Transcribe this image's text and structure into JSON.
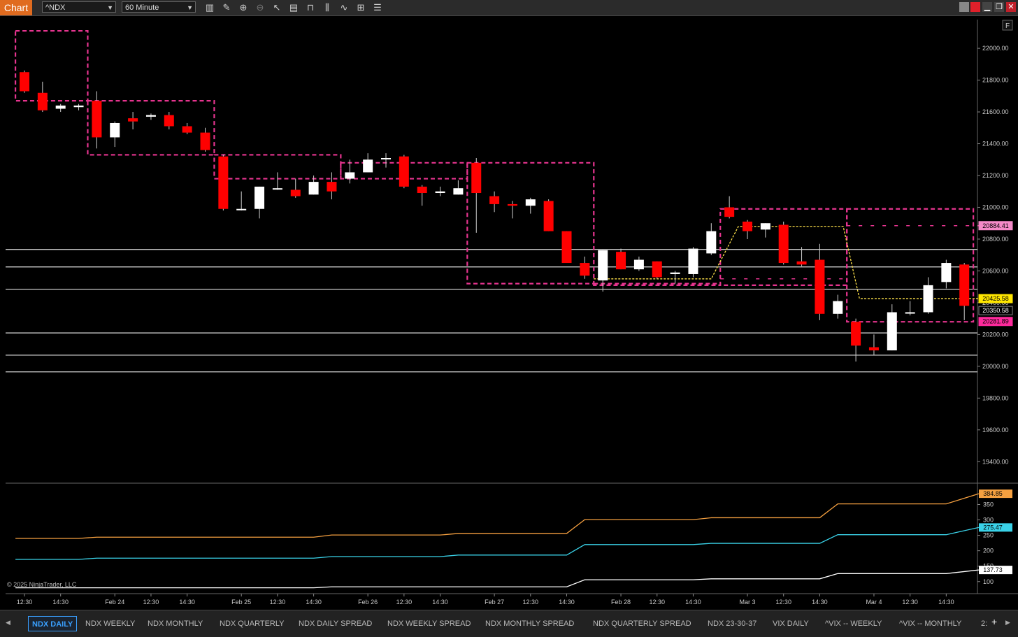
{
  "toolbar": {
    "chart_label": "Chart",
    "instrument": "^NDX",
    "interval": "60 Minute",
    "tools": [
      "bar-chart-icon",
      "pencil-icon",
      "zoom-in-icon",
      "zoom-out-icon",
      "cursor-icon",
      "properties-icon",
      "template-icon",
      "indicators-icon",
      "strategies-icon",
      "data-box-icon",
      "list-icon"
    ]
  },
  "corner_button": "F",
  "copyright": "© 2025 NinjaTrader, LLC",
  "tabs": [
    {
      "label": "NDX DAILY",
      "active": true
    },
    {
      "label": "NDX WEEKLY"
    },
    {
      "label": "NDX MONTHLY"
    },
    {
      "label": "NDX QUARTERLY"
    },
    {
      "label": "NDX DAILY SPREAD"
    },
    {
      "label": "NDX WEEKLY SPREAD"
    },
    {
      "label": "NDX MONTHLY SPREAD"
    },
    {
      "label": "NDX QUARTERLY SPREAD"
    },
    {
      "label": "NDX 23-30-37"
    },
    {
      "label": "VIX DAILY"
    },
    {
      "label": "^VIX -- WEEKLY"
    },
    {
      "label": "^VIX -- MONTHLY"
    },
    {
      "label": "2:"
    }
  ],
  "colors": {
    "bull": "#ffffff",
    "bear": "#ff0000",
    "pink": "#e6348f",
    "yellow": "#ffe24a",
    "orange": "#f5a040",
    "cyan": "#3ad2e8",
    "grid": "#e0e0e0",
    "axis_text": "#cccccc"
  },
  "chart_data": {
    "type": "candlestick",
    "instrument": "^NDX",
    "interval": "60 Minute",
    "x_tick_labels": [
      "12:30",
      "14:30",
      "Feb 24",
      "12:30",
      "14:30",
      "Feb 25",
      "12:30",
      "14:30",
      "Feb 26",
      "12:30",
      "14:30",
      "Feb 27",
      "12:30",
      "14:30",
      "Feb 28",
      "12:30",
      "14:30",
      "Mar 3",
      "12:30",
      "14:30",
      "Mar 4",
      "12:30",
      "14:30"
    ],
    "x_tick_bar_index": [
      0,
      2,
      5,
      7,
      9,
      12,
      14,
      16,
      19,
      21,
      23,
      26,
      28,
      30,
      33,
      35,
      37,
      40,
      42,
      44,
      47,
      49,
      51
    ],
    "price_axis": {
      "min": 19300,
      "max": 22150,
      "ticks": [
        19400,
        19600,
        19800,
        20000,
        20200,
        20400,
        20600,
        20800,
        21000,
        21200,
        21400,
        21600,
        21800,
        22000
      ],
      "tick_labels": [
        "19400.00",
        "19600.00",
        "19800.00",
        "20000.00",
        "20200.00",
        "20400.00",
        "20600.00",
        "20800.00",
        "21000.00",
        "21200.00",
        "21400.00",
        "21600.00",
        "21800.00",
        "22000.00"
      ]
    },
    "candles": [
      [
        21850,
        21860,
        21720,
        21730
      ],
      [
        21720,
        21790,
        21600,
        21610
      ],
      [
        21620,
        21650,
        21600,
        21640
      ],
      [
        21630,
        21650,
        21610,
        21640
      ],
      [
        21670,
        21730,
        21370,
        21440
      ],
      [
        21440,
        21540,
        21380,
        21530
      ],
      [
        21560,
        21600,
        21490,
        21540
      ],
      [
        21570,
        21590,
        21550,
        21580
      ],
      [
        21580,
        21600,
        21490,
        21510
      ],
      [
        21510,
        21530,
        21460,
        21470
      ],
      [
        21470,
        21500,
        21350,
        21360
      ],
      [
        21320,
        21330,
        20980,
        20990
      ],
      [
        20990,
        21100,
        20980,
        20990
      ],
      [
        20990,
        21130,
        20930,
        21130
      ],
      [
        21120,
        21220,
        21110,
        21120
      ],
      [
        21110,
        21180,
        21060,
        21070
      ],
      [
        21080,
        21200,
        21080,
        21160
      ],
      [
        21160,
        21220,
        21050,
        21100
      ],
      [
        21180,
        21300,
        21150,
        21220
      ],
      [
        21220,
        21340,
        21220,
        21300
      ],
      [
        21310,
        21340,
        21250,
        21310
      ],
      [
        21320,
        21330,
        21120,
        21130
      ],
      [
        21130,
        21140,
        21010,
        21090
      ],
      [
        21090,
        21130,
        21070,
        21100
      ],
      [
        21080,
        21170,
        21080,
        21120
      ],
      [
        21280,
        21310,
        20840,
        21090
      ],
      [
        21070,
        21100,
        20970,
        21020
      ],
      [
        21020,
        21040,
        20930,
        21010
      ],
      [
        21010,
        21060,
        20960,
        21050
      ],
      [
        21040,
        21050,
        20850,
        20850
      ],
      [
        20850,
        20850,
        20650,
        20650
      ],
      [
        20650,
        20690,
        20550,
        20570
      ],
      [
        20540,
        20730,
        20470,
        20730
      ],
      [
        20720,
        20740,
        20610,
        20610
      ],
      [
        20610,
        20690,
        20600,
        20670
      ],
      [
        20660,
        20660,
        20550,
        20560
      ],
      [
        20580,
        20600,
        20520,
        20590
      ],
      [
        20580,
        20750,
        20560,
        20740
      ],
      [
        20710,
        20900,
        20700,
        20850
      ],
      [
        21000,
        21070,
        20930,
        20940
      ],
      [
        20910,
        20920,
        20800,
        20850
      ],
      [
        20860,
        20900,
        20810,
        20900
      ],
      [
        20890,
        20910,
        20640,
        20650
      ],
      [
        20660,
        20750,
        20630,
        20640
      ],
      [
        20670,
        20770,
        20290,
        20330
      ],
      [
        20330,
        20450,
        20300,
        20410
      ],
      [
        20280,
        20300,
        20030,
        20130
      ],
      [
        20120,
        20200,
        20070,
        20100
      ],
      [
        20100,
        20390,
        20100,
        20340
      ],
      [
        20340,
        20410,
        20320,
        20340
      ],
      [
        20340,
        20560,
        20330,
        20510
      ],
      [
        20530,
        20670,
        20490,
        20650
      ],
      [
        20640,
        20650,
        20290,
        20380
      ]
    ],
    "horizontal_levels": [
      20735,
      20625,
      20485,
      20210,
      20070,
      19965
    ],
    "pink_boxes": [
      {
        "from": -0.5,
        "to": 3.5,
        "low": 21670,
        "high": 22110
      },
      {
        "from": 3.5,
        "to": 10.5,
        "low": 21330,
        "high": 21670
      },
      {
        "from": 10.5,
        "to": 17.5,
        "low": 21180,
        "high": 21330
      },
      {
        "from": 17.5,
        "to": 24.5,
        "low": 21180,
        "high": 21280
      },
      {
        "from": 24.5,
        "to": 31.5,
        "low": 20520,
        "high": 21280
      },
      {
        "from": 31.5,
        "to": 38.5,
        "low": 20510,
        "high": 20520
      },
      {
        "from": 38.5,
        "to": 45.5,
        "low": 20510,
        "high": 20990
      },
      {
        "from": 45.5,
        "to": 52.5,
        "low": 20280,
        "high": 20990
      }
    ],
    "pink_dashed_levels": [
      {
        "from": 38.5,
        "to": 45.5,
        "y": 20550,
        "style": "sparse"
      },
      {
        "from": 45.5,
        "to": 52.8,
        "y": 20884.41,
        "style": "sparse"
      }
    ],
    "yellow_path": [
      [
        31.5,
        20550
      ],
      [
        38,
        20550
      ],
      [
        39.5,
        20880
      ],
      [
        45.3,
        20880
      ],
      [
        46.2,
        20425.58
      ],
      [
        52.8,
        20425.58
      ]
    ],
    "price_markers": [
      {
        "label": "20884.41",
        "value": 20884.41,
        "bg": "#f48ac8",
        "fg": "#000"
      },
      {
        "label": "20425.58",
        "value": 20425.58,
        "bg": "#ffe600",
        "fg": "#000"
      },
      {
        "label": "20350.58",
        "value": 20350.58,
        "bg": "#000",
        "fg": "#fff",
        "border": "#888"
      },
      {
        "label": "20281.89",
        "value": 20281.89,
        "bg": "#ff2a9d",
        "fg": "#000"
      }
    ],
    "lower_panel": {
      "axis": {
        "min": 70,
        "max": 410,
        "ticks": [
          100,
          150,
          200,
          250,
          300,
          350
        ],
        "tick_labels": [
          "100",
          "150",
          "200",
          "250",
          "300",
          "350"
        ]
      },
      "series": [
        {
          "color": "#f5a040",
          "label": "384.85",
          "last": 384.85,
          "steps": [
            [
              -0.5,
              240
            ],
            [
              3,
              240
            ],
            [
              4,
              244
            ],
            [
              16,
              244
            ],
            [
              17,
              251
            ],
            [
              23,
              251
            ],
            [
              24,
              256
            ],
            [
              30,
              256
            ],
            [
              31,
              301
            ],
            [
              37,
              301
            ],
            [
              38,
              307
            ],
            [
              44,
              307
            ],
            [
              45,
              352
            ],
            [
              51,
              352
            ],
            [
              52.8,
              384.85
            ]
          ]
        },
        {
          "color": "#3ad2e8",
          "label": "275.47",
          "last": 275.47,
          "steps": [
            [
              -0.5,
              172
            ],
            [
              3,
              172
            ],
            [
              4,
              176
            ],
            [
              16,
              176
            ],
            [
              17,
              181
            ],
            [
              23,
              181
            ],
            [
              24,
              186
            ],
            [
              30,
              186
            ],
            [
              31,
              220
            ],
            [
              37,
              220
            ],
            [
              38,
              224
            ],
            [
              44,
              224
            ],
            [
              45,
              252
            ],
            [
              51,
              252
            ],
            [
              52.8,
              275.47
            ]
          ]
        },
        {
          "color": "#ffffff",
          "label": "137.73",
          "last": 137.73,
          "steps": [
            [
              -0.5,
              80
            ],
            [
              16,
              80
            ],
            [
              17,
              83
            ],
            [
              30,
              83
            ],
            [
              31,
              106
            ],
            [
              37,
              106
            ],
            [
              38,
              109
            ],
            [
              44,
              109
            ],
            [
              45,
              126
            ],
            [
              51,
              126
            ],
            [
              52.8,
              137.73
            ]
          ]
        }
      ]
    }
  }
}
